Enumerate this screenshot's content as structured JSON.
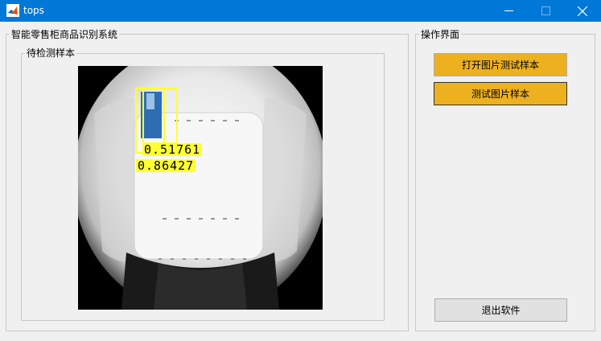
{
  "window": {
    "title": "tops",
    "controls": {
      "minimize": "minimize-icon",
      "maximize": "maximize-icon",
      "close": "close-icon"
    }
  },
  "main_panel": {
    "title": "智能零售柜商品识别系统",
    "sample_panel": {
      "title": "待检测样本",
      "detections": [
        {
          "score": "0.51761"
        },
        {
          "score": "0.86427"
        }
      ]
    }
  },
  "ops_panel": {
    "title": "操作界面",
    "open_button": "打开图片测试样本",
    "test_button": "测试图片样本",
    "exit_button": "退出软件"
  },
  "colors": {
    "titlebar": "#0078d7",
    "button_accent": "#edb120",
    "box_yellow": "#ffff33",
    "background": "#f0f0f0"
  }
}
